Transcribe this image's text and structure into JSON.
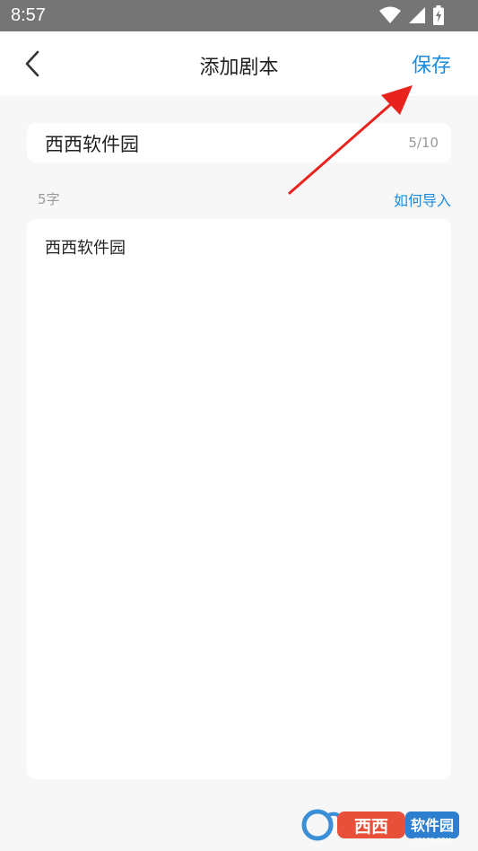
{
  "status_bar": {
    "time": "8:57",
    "icons": [
      "wifi-icon",
      "signal-icon",
      "battery-charging-icon"
    ]
  },
  "app_bar": {
    "back_icon": "chevron-left-icon",
    "title": "添加剧本",
    "save_label": "保存"
  },
  "script_title": {
    "value": "西西软件园",
    "counter": "5/10"
  },
  "script_content": {
    "word_count": "5字",
    "import_label": "如何导入",
    "value": "西西软件园"
  },
  "watermark": {
    "text": "西西软件园",
    "subtext": "CR173.COM"
  },
  "colors": {
    "accent": "#1a8be0",
    "annotation": "#e8221c",
    "status_bar": "#757575",
    "background": "#f7f7f7"
  }
}
